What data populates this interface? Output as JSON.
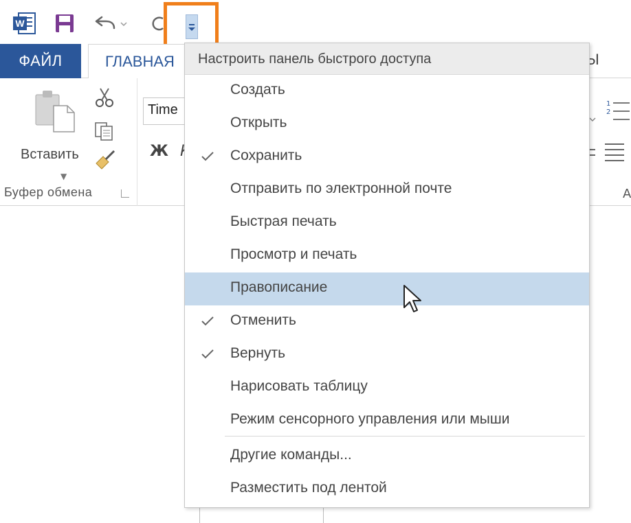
{
  "tabs": {
    "file": "ФАЙЛ",
    "home": "ГЛАВНАЯ",
    "right_partial": "ЦЫ"
  },
  "clipboard": {
    "paste": "Вставить",
    "group_label": "Буфер обмена"
  },
  "font": {
    "name": "Time",
    "bold": "Ж",
    "italic": "К"
  },
  "right_partial_label": "А",
  "menu": {
    "header": "Настроить панель быстрого доступа",
    "items": [
      {
        "label": "Создать",
        "checked": false
      },
      {
        "label": "Открыть",
        "checked": false
      },
      {
        "label": "Сохранить",
        "checked": true
      },
      {
        "label": "Отправить по электронной почте",
        "checked": false
      },
      {
        "label": "Быстрая печать",
        "checked": false
      },
      {
        "label": "Просмотр и печать",
        "checked": false
      },
      {
        "label": "Правописание",
        "checked": false,
        "highlighted": true
      },
      {
        "label": "Отменить",
        "checked": true
      },
      {
        "label": "Вернуть",
        "checked": true
      },
      {
        "label": "Нарисовать таблицу",
        "checked": false
      },
      {
        "label": "Режим сенсорного управления или мыши",
        "checked": false
      }
    ],
    "more_commands": "Другие команды...",
    "show_below": "Разместить под лентой"
  },
  "colors": {
    "accent_blue": "#2b579a",
    "highlight_border": "#f07f1b",
    "menu_hover": "#c5d9ec",
    "word_blue": "#2b579a",
    "save_purple": "#7a3a92"
  }
}
